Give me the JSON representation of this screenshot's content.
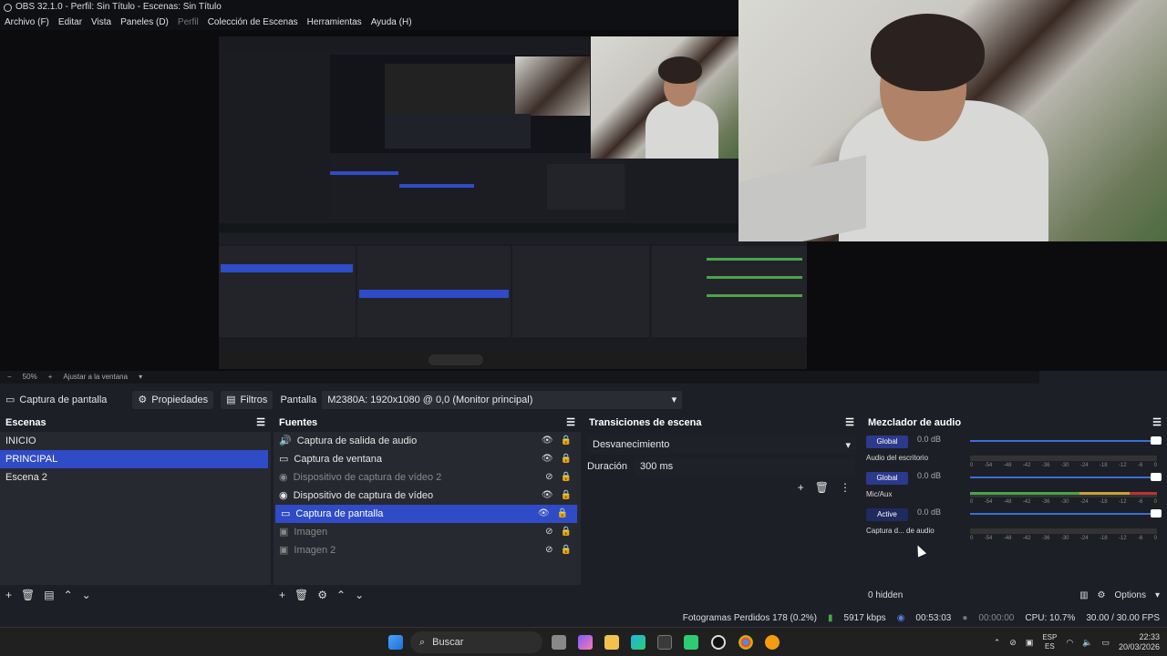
{
  "window": {
    "title": "OBS 32.1.0 - Perfil: Sin Título - Escenas: Sin Título"
  },
  "menu": [
    {
      "label": "Archivo (F)"
    },
    {
      "label": "Editar"
    },
    {
      "label": "Vista"
    },
    {
      "label": "Paneles (D)"
    },
    {
      "label": "Perfil"
    },
    {
      "label": "Colección de Escenas"
    },
    {
      "label": "Herramientas"
    },
    {
      "label": "Ayuda (H)"
    }
  ],
  "zoom": {
    "level": "50%",
    "fit_label": "Ajustar a la ventana"
  },
  "source_toolbar": {
    "source_name": "Captura de pantalla",
    "properties_label": "Propiedades",
    "filters_label": "Filtros",
    "screen_label": "Pantalla",
    "screen_value": "M2380A: 1920x1080 @ 0,0 (Monitor principal)"
  },
  "scenes": {
    "title": "Escenas",
    "items": [
      {
        "label": "INICIO"
      },
      {
        "label": "PRINCIPAL"
      },
      {
        "label": "Escena 2"
      }
    ]
  },
  "sources": {
    "title": "Fuentes",
    "items": [
      {
        "label": "Captura de salida de audio",
        "icon": "speaker-icon"
      },
      {
        "label": "Captura de ventana",
        "icon": "window-icon"
      },
      {
        "label": "Dispositivo de captura de vídeo 2",
        "icon": "camera-icon"
      },
      {
        "label": "Dispositivo de captura de vídeo",
        "icon": "camera-icon"
      },
      {
        "label": "Captura de pantalla",
        "icon": "monitor-icon"
      },
      {
        "label": "Imagen",
        "icon": "image-icon"
      },
      {
        "label": "Imagen 2",
        "icon": "image-icon"
      }
    ]
  },
  "transitions": {
    "title": "Transiciones de escena",
    "selected": "Desvanecimiento",
    "duration_label": "Duración",
    "duration_value": "300 ms"
  },
  "mixer": {
    "title": "Mezclador de audio",
    "hidden_label": "0 hidden",
    "options_label": "Options",
    "tracks": [
      {
        "badge": "Global",
        "db": "0.0 dB",
        "name": "Audio del escritorio"
      },
      {
        "badge": "Global",
        "db": "0.0 dB",
        "name": "Mic/Aux"
      },
      {
        "badge": "Active",
        "db": "0.0 dB",
        "name": "Captura d... de audio"
      }
    ],
    "ticks": [
      "0",
      "-54",
      "-48",
      "-42",
      "-36",
      "-30",
      "-24",
      "-18",
      "-12",
      "-6",
      "0"
    ]
  },
  "status": {
    "dropped": "Fotogramas Perdidos 178 (0.2%)",
    "bitrate": "5917 kbps",
    "live_time": "00:53:03",
    "rec_time": "00:00:00",
    "cpu": "CPU: 10.7%",
    "fps": "30.00 / 30.00 FPS"
  },
  "taskbar": {
    "search_label": "Buscar",
    "lang_top": "ESP",
    "lang_bottom": "ES",
    "time": "22:33",
    "date": "20/03/2026"
  }
}
